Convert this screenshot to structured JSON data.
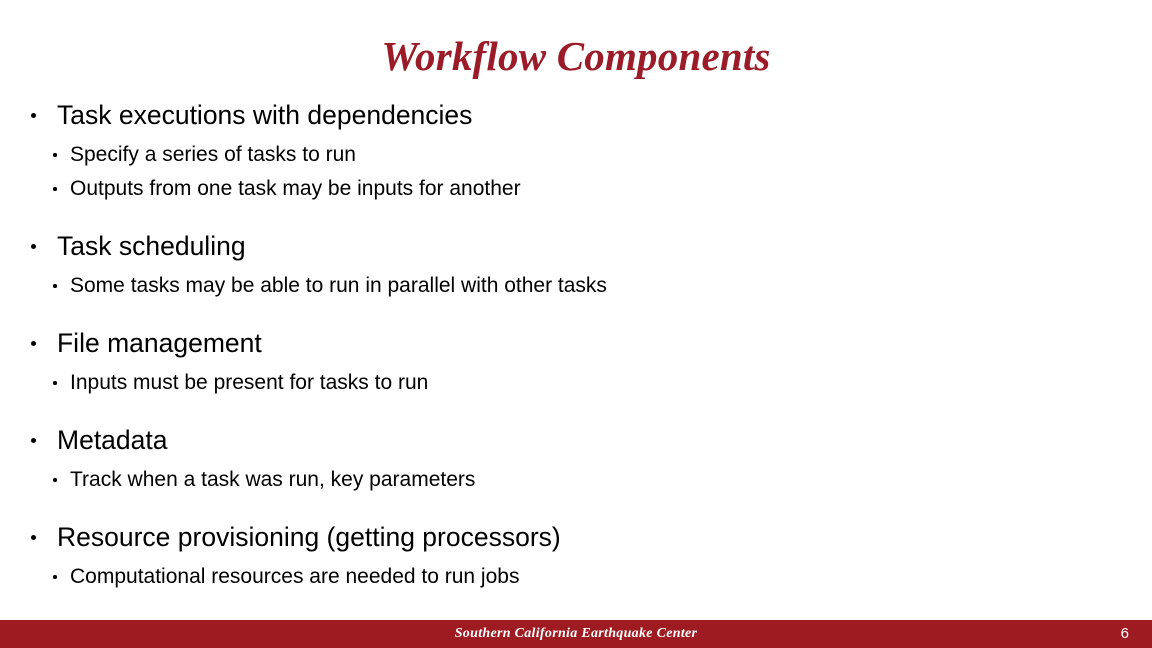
{
  "slide": {
    "title": "Workflow Components",
    "title_color": "#9B1B28",
    "background_color": "#ffffff",
    "body_text_color": "#000000"
  },
  "bullets": [
    {
      "label": "Task executions with dependencies",
      "children": [
        {
          "label": "Specify a series of tasks to run"
        },
        {
          "label": "Outputs from one task may be inputs for another"
        }
      ]
    },
    {
      "label": "Task scheduling",
      "children": [
        {
          "label": "Some tasks may be able to run in parallel with other tasks"
        }
      ]
    },
    {
      "label": "File management",
      "children": [
        {
          "label": "Inputs must be present for tasks to run"
        }
      ]
    },
    {
      "label": "Metadata",
      "children": [
        {
          "label": "Track when a task was run, key parameters"
        }
      ]
    },
    {
      "label": "Resource provisioning (getting processors)",
      "children": [
        {
          "label": "Computational resources are needed to run jobs"
        }
      ]
    }
  ],
  "footer": {
    "organization": "Southern California Earthquake Center",
    "page_number": "6",
    "bar_color": "#9E1B22",
    "text_color": "#ffffff"
  }
}
